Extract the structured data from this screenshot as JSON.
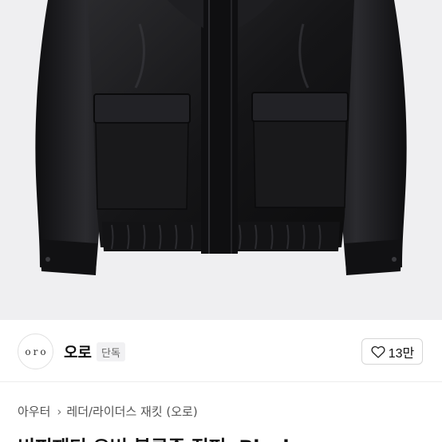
{
  "product_image": {
    "alt_icon": "black-leather-jacket-photo"
  },
  "brand": {
    "logo_text": "oro",
    "name": "오로",
    "badge": "단독"
  },
  "like": {
    "icon": "heart-icon",
    "count": "13만"
  },
  "breadcrumb": {
    "items": [
      "아우터",
      "레더/라이더스 재킷 (오로)"
    ],
    "separator_icon": "chevron-right-icon"
  },
  "product": {
    "title": "비피재디 오버 블루종 점퍼, Black"
  },
  "colors": {
    "background": "#efeff1",
    "jacket": "#1a1a1c",
    "text": "#111111"
  }
}
